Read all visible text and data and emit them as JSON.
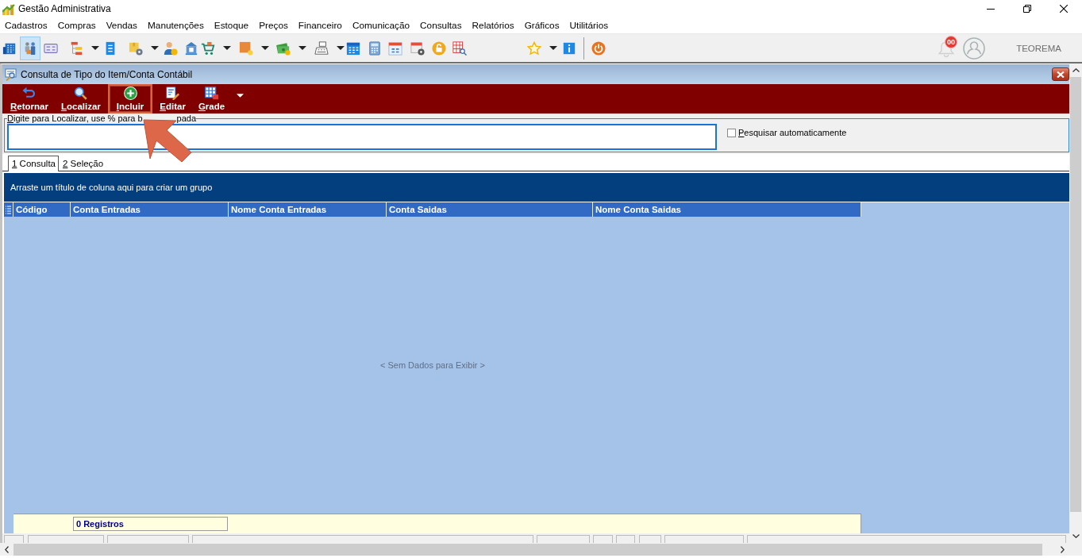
{
  "window": {
    "title": "Gestão Administrativa"
  },
  "menu": [
    "Cadastros",
    "Compras",
    "Vendas",
    "Manutenções",
    "Estoque",
    "Preços",
    "Financeiro",
    "Comunicação",
    "Consultas",
    "Relatórios",
    "Gráficos",
    "Utilitários"
  ],
  "toolbar": {
    "buttons": [
      {
        "selected": false,
        "dropdown": false
      },
      {
        "selected": true,
        "dropdown": false
      },
      {
        "selected": false,
        "dropdown": false
      },
      {
        "selected": false,
        "dropdown": true
      },
      {
        "selected": false,
        "dropdown": false
      },
      {
        "selected": false,
        "dropdown": true
      },
      {
        "selected": false,
        "dropdown": false
      },
      {
        "selected": false,
        "dropdown": false
      },
      {
        "selected": false,
        "dropdown": true
      },
      {
        "selected": false,
        "dropdown": true
      },
      {
        "selected": false,
        "dropdown": true
      },
      {
        "selected": false,
        "dropdown": true
      },
      {
        "selected": false,
        "dropdown": false
      },
      {
        "selected": false,
        "dropdown": false
      },
      {
        "selected": false,
        "dropdown": false
      },
      {
        "selected": false,
        "dropdown": false
      },
      {
        "selected": false,
        "dropdown": false
      },
      {
        "selected": false,
        "dropdown": false
      },
      {
        "selected": false,
        "dropdown": true
      },
      {
        "selected": false,
        "dropdown": false
      },
      {
        "selected": false,
        "dropdown": false
      }
    ],
    "notification_badge": "00",
    "user_name": "TEOREMA"
  },
  "child_window": {
    "title": "Consulta de Tipo do Item/Conta Contábil",
    "actions": [
      {
        "label": "Retornar",
        "highlighted": false
      },
      {
        "label": "Localizar",
        "highlighted": false
      },
      {
        "label": "Incluir",
        "highlighted": true
      },
      {
        "label": "Editar",
        "highlighted": false
      },
      {
        "label": "Grade",
        "highlighted": false
      }
    ],
    "actions_dropdown": true,
    "pointer_arrow": true,
    "search_caption": [
      "Digite para Localizar, use % para b",
      "pada"
    ],
    "auto_search": {
      "label": "Pesquisar automaticamente",
      "checked": false
    },
    "tabs": [
      {
        "label": "1 Consulta",
        "selected": true
      },
      {
        "label": "2 Seleção",
        "selected": false
      }
    ],
    "grid": {
      "group_hint": "Arraste um título de coluna aqui para criar um grupo",
      "columns": [
        "Código",
        "Conta Entradas",
        "Nome Conta Entradas",
        "Conta Saidas",
        "Nome Conta Saidas"
      ],
      "empty_text": "< Sem Dados para Exibir >",
      "record_count": "0 Registros"
    }
  }
}
